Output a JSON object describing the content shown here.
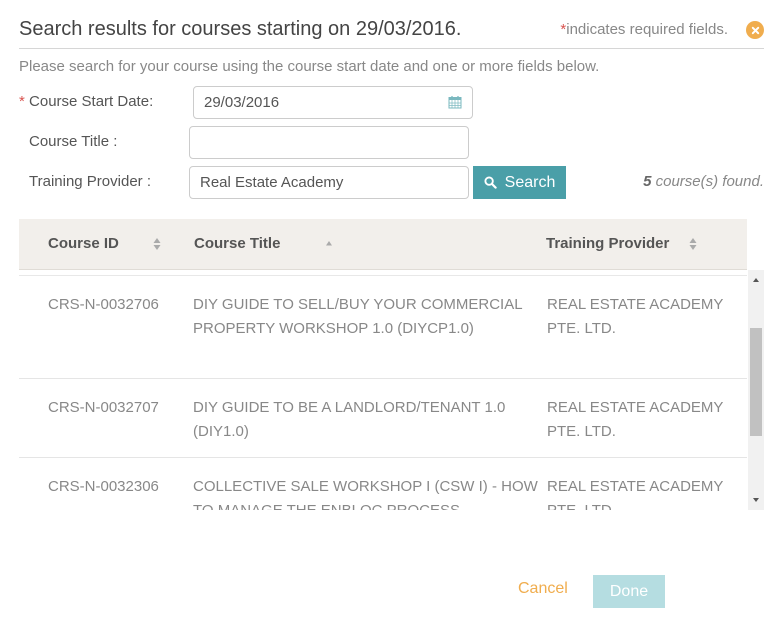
{
  "header": {
    "title": "Search results for courses starting on 29/03/2016.",
    "required_star": "*",
    "required_note": "indicates required fields."
  },
  "instructions": "Please search for your course using the course start date and one or more fields below.",
  "form": {
    "start_date": {
      "required_star": "*",
      "label": "Course Start Date:",
      "value": "29/03/2016",
      "icon": "calendar-icon"
    },
    "course_title": {
      "label": "Course Title :",
      "value": ""
    },
    "training_provider": {
      "label": "Training Provider :",
      "value": "Real Estate Academy"
    },
    "search_button": {
      "label": "Search",
      "icon": "search-icon"
    }
  },
  "results": {
    "count": "5",
    "count_suffix": " course(s) found."
  },
  "table": {
    "columns": [
      {
        "label": "Course ID",
        "sort": "both"
      },
      {
        "label": "Course Title",
        "sort": "asc"
      },
      {
        "label": "Training Provider",
        "sort": "both"
      }
    ],
    "rows": [
      {
        "id": "CRS-N-0032706",
        "title": "DIY GUIDE TO SELL/BUY YOUR COMMERCIAL PROPERTY WORKSHOP 1.0 (DIYCP1.0)",
        "provider": "REAL ESTATE ACADEMY PTE. LTD."
      },
      {
        "id": "CRS-N-0032707",
        "title": "DIY GUIDE TO BE A LANDLORD/TENANT 1.0 (DIY1.0)",
        "provider": "REAL ESTATE ACADEMY PTE. LTD."
      },
      {
        "id": "CRS-N-0032306",
        "title": "COLLECTIVE SALE WORKSHOP I (CSW I) - HOW TO MANAGE THE ENBLOC PROCESS",
        "provider": "REAL ESTATE ACADEMY PTE. LTD."
      }
    ]
  },
  "footer": {
    "cancel_label": "Cancel",
    "done_label": "Done"
  },
  "colors": {
    "accent": "#4a9fa8",
    "warning": "#f0ad4e",
    "required": "#d9534f",
    "done_disabled": "#b5dde1"
  }
}
